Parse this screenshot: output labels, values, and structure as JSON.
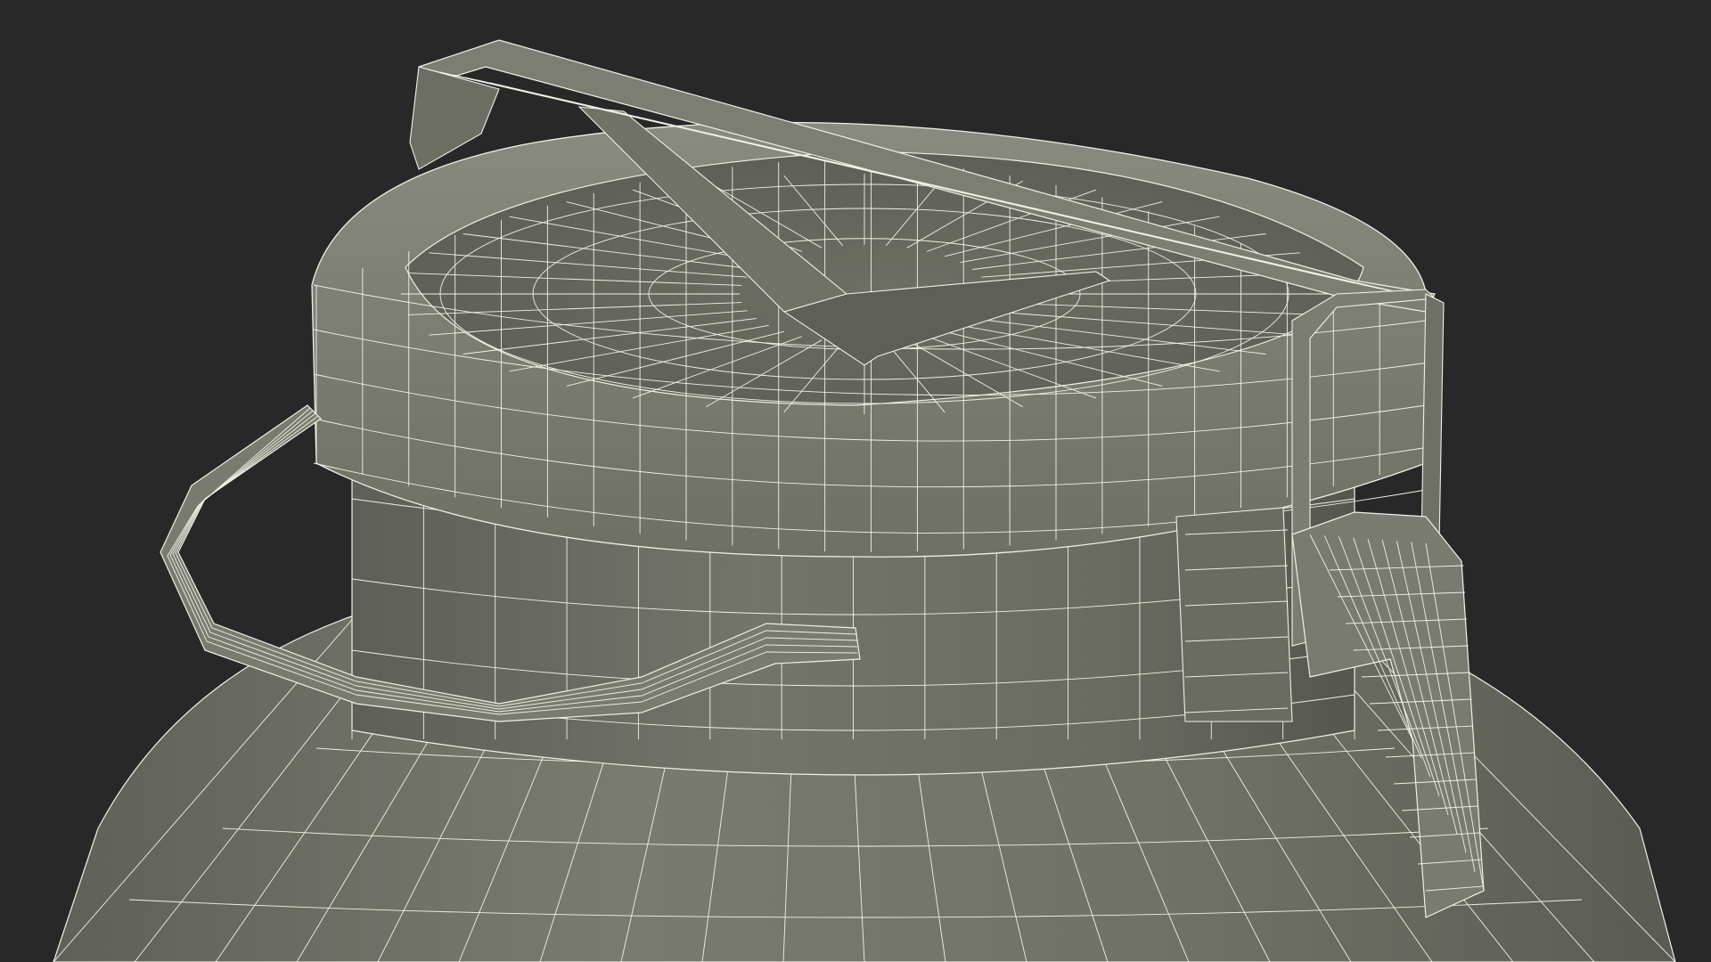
{
  "scene": {
    "background_color": "#282828",
    "mesh_fill_color": "#75766b",
    "mesh_shadow_color": "#55564e",
    "mesh_highlight_color": "#8a8b7f",
    "wireframe_color": "#f2f0e6"
  }
}
